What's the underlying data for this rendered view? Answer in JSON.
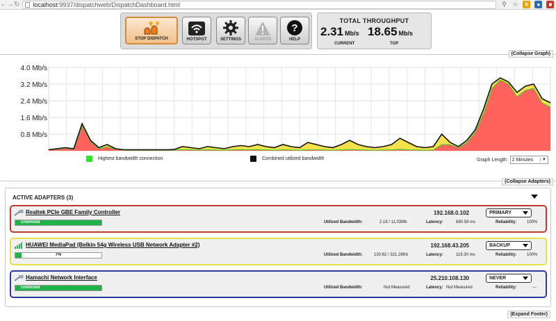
{
  "browser": {
    "url_host": "localhost",
    "url_path": ":9937/dispatchweb/DispatchDashboard.html"
  },
  "toolbar": {
    "buttons": [
      {
        "label": "STOP DISPATCH"
      },
      {
        "label": "HOTSPOT"
      },
      {
        "label": "SETTINGS"
      },
      {
        "label": "ALERTS"
      },
      {
        "label": "HELP"
      }
    ]
  },
  "throughput": {
    "title": "TOTAL THROUGHPUT",
    "current_value": "2.31",
    "current_unit": "Mb/s",
    "current_label": "CURRENT",
    "top_value": "18.65",
    "top_unit": "Mb/s",
    "top_label": "TOP"
  },
  "graph_section": {
    "collapse_label": "(Collapse Graph)",
    "legend_highest": "Highest bandwidth connection",
    "legend_combined": "Combined utilized bandwidth",
    "graph_length_label": "Graph Length:",
    "graph_length_value": "2 Minutes",
    "colors": {
      "highest": "#33dd33",
      "combined": "#111111",
      "red_fill": "#ff5c5c",
      "yellow_fill": "#f5e24a"
    }
  },
  "chart_data": {
    "type": "area",
    "ylim": [
      0,
      4.0
    ],
    "yticks": [
      "4.0 Mb/s",
      "3.2 Mb/s",
      "2.4 Mb/s",
      "1.6 Mb/s",
      "0.8 Mb/s"
    ],
    "ytick_values": [
      4.0,
      3.2,
      2.4,
      1.6,
      0.8
    ],
    "grid": true,
    "series": [
      {
        "name": "Combined utilized bandwidth",
        "values": [
          0.05,
          0.1,
          0.15,
          0.1,
          1.3,
          0.5,
          0.15,
          0.3,
          0.1,
          0.05,
          0.05,
          0.05,
          0.05,
          0.05,
          0.05,
          0.06,
          0.2,
          0.15,
          0.1,
          0.2,
          0.15,
          0.1,
          0.2,
          0.25,
          0.2,
          0.3,
          0.2,
          0.15,
          0.3,
          0.2,
          0.15,
          0.4,
          0.3,
          0.2,
          0.15,
          0.3,
          0.5,
          0.3,
          0.2,
          0.15,
          0.2,
          0.3,
          0.6,
          0.4,
          0.2,
          0.15,
          0.2,
          0.8,
          0.4,
          0.2,
          0.5,
          1.0,
          2.0,
          3.2,
          3.5,
          3.3,
          2.8,
          3.1,
          3.2,
          2.5,
          2.3
        ]
      },
      {
        "name": "Highest bandwidth connection",
        "values": [
          0.05,
          0.08,
          0.12,
          0.08,
          1.2,
          0.45,
          0.1,
          0.2,
          0.08,
          0.03,
          0.03,
          0.03,
          0.03,
          0.03,
          0.03,
          0.03,
          0.05,
          0.05,
          0.04,
          0.05,
          0.04,
          0.03,
          0.05,
          0.06,
          0.05,
          0.06,
          0.04,
          0.03,
          0.05,
          0.04,
          0.03,
          0.05,
          0.05,
          0.04,
          0.03,
          0.05,
          0.06,
          0.05,
          0.04,
          0.03,
          0.04,
          0.05,
          0.07,
          0.05,
          0.04,
          0.03,
          0.04,
          0.3,
          0.3,
          0.15,
          0.4,
          0.9,
          1.8,
          3.0,
          3.4,
          3.2,
          2.6,
          2.9,
          3.0,
          2.3,
          2.1
        ]
      }
    ]
  },
  "adapters_section": {
    "collapse_label": "(Collapse Adapters)",
    "title": "ACTIVE ADAPTERS (3)",
    "bandwidth_label": "Utilized Bandwidth:",
    "latency_label": "Latency:",
    "reliability_label": "Reliability:",
    "adapters": [
      {
        "name": "Realtek PCIe GBE Family Controller",
        "ip": "192.168.0.102",
        "mode": "PRIMARY",
        "bar_text": "Unlimited",
        "bar_percent": 100,
        "bandwidth": "2.18 / 11.03Mb",
        "latency": "690.58 ms",
        "reliability": "100%",
        "border_color": "#c0392b"
      },
      {
        "name": "HUAWEI MediaPad (Belkin 54g Wireless USB Network Adapter #2)",
        "ip": "192.168.43.205",
        "mode": "BACKUP",
        "bar_text": "7%",
        "bar_percent": 7,
        "bandwidth": "130.62 / 321.28Kb",
        "latency": "119.30 ms",
        "reliability": "100%",
        "border_color": "#e8e04a"
      },
      {
        "name": "Hamachi Network Interface",
        "ip": "25.210.108.130",
        "mode": "NEVER",
        "bar_text": "Unlimited",
        "bar_percent": 100,
        "bandwidth": "Not Measured",
        "latency": "Not Measured",
        "reliability": "---",
        "border_color": "#2b3a9b"
      }
    ]
  },
  "footer": {
    "expand_label": "(Expand Footer)"
  }
}
